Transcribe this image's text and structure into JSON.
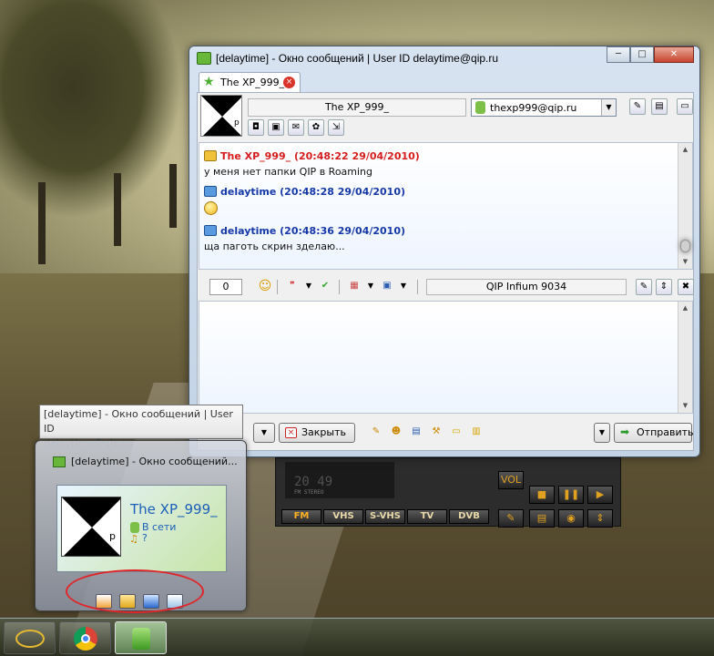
{
  "window": {
    "title": "[delaytime] - Окно сообщений | User ID delaytime@qip.ru",
    "minimize": "─",
    "maximize": "□",
    "close": "✕"
  },
  "tab": {
    "label": "The XP_999_",
    "close": "×"
  },
  "contact": {
    "name": "The XP_999_",
    "account": "thexp999@qip.ru",
    "avatar_letter": "р"
  },
  "messages": [
    {
      "header": "The XP_999_ (20:48:22 29/04/2010)",
      "text": "у меня нет папки QIP в Roaming",
      "color": "#d51d1d"
    },
    {
      "header": "delaytime (20:48:28 29/04/2010)",
      "text": "",
      "color": "#1639a8"
    },
    {
      "header": "delaytime (20:48:36 29/04/2010)",
      "text": "ща паготь скрин зделаю...",
      "color": "#1639a8"
    }
  ],
  "toolbar": {
    "counter": "0",
    "client_info": "QIP Infium 9034"
  },
  "buttons": {
    "close": "Закрыть",
    "send": "Отправить"
  },
  "tooltip": {
    "line1": "[delaytime] - Окно сообщений | User ID",
    "line2": "delaytime@qip.ru"
  },
  "thumbnail": {
    "title": "[delaytime] - Окно сообщений...",
    "name": "The XP_999_",
    "status": "В сети",
    "extra": "?"
  },
  "radio": {
    "display": "20 49",
    "band_label": "FM STEREO",
    "buttons": [
      "FM",
      "VHS",
      "S-VHS",
      "TV",
      "DVB"
    ],
    "vol": "VOL"
  },
  "colors": {
    "accent": "#69b73a",
    "self_color": "#1639a8",
    "peer_color": "#d51d1d",
    "highlight_oval": "#e0262a"
  }
}
